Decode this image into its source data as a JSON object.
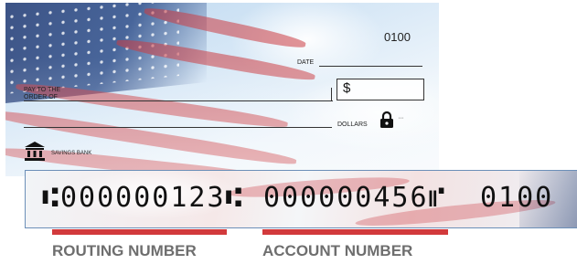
{
  "check": {
    "number": "0100",
    "date_label": "DATE",
    "pay_to_label_line1": "PAY TO THE",
    "pay_to_label_line2": "ORDER OF",
    "amount_symbol": "$",
    "dollars_label": "DOLLARS",
    "bank_name": "SAVINGS BANK",
    "icons": [
      "lock-icon",
      "bank-icon"
    ]
  },
  "micr": {
    "routing": "⑆000000123⑆",
    "account": "000000456⑈",
    "check_number": "0100"
  },
  "labels": {
    "routing": "ROUTING NUMBER",
    "account": "ACCOUNT NUMBER"
  },
  "colors": {
    "underline": "#d23a3c",
    "caption": "#6e6e6e",
    "flag_blue": "#2f4478",
    "flag_red": "#cc3c42"
  }
}
